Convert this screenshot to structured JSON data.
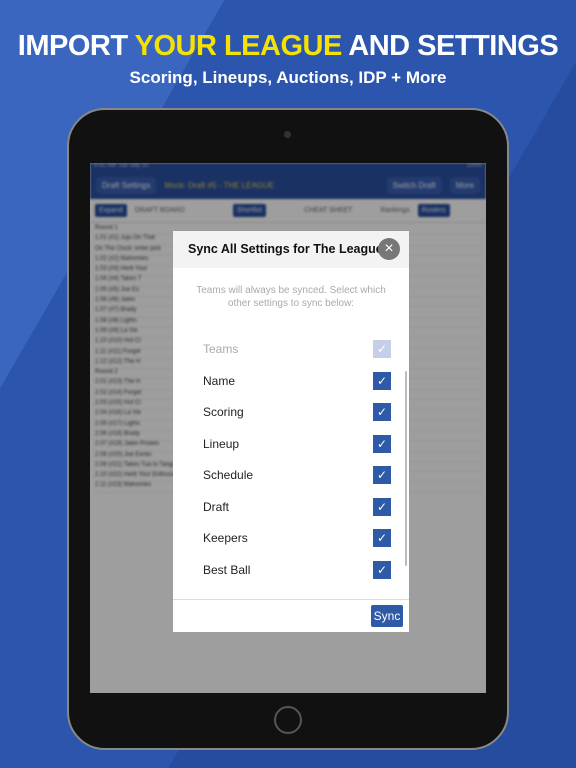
{
  "promo": {
    "headline_pre": "IMPORT ",
    "headline_highlight": "YOUR LEAGUE",
    "headline_post": " AND SETTINGS",
    "subtitle": "Scoring, Lineups, Auctions, IDP + More"
  },
  "app": {
    "status_time": "9:41 AM  Tue Sep 10",
    "status_battery": "100%",
    "draft_settings": "Draft Settings",
    "mock_title": "Mock: Draft #5 - THE LEAGUE",
    "switch_draft": "Switch Draft",
    "more": "More",
    "expand": "Expand",
    "draft_board": "DRAFT BOARD",
    "shortlist": "Shortlist",
    "cheat_sheet": "CHEAT SHEET",
    "rankings": "Rankings",
    "rosters": "Rosters",
    "rows": [
      "Round 1",
      "1.01 (#1) Juju On That",
      "On The Clock: enter pick",
      "1.02 (#2) Mahomies",
      "1.03 (#3) Herb Your",
      "1.04 (#4) Takes T",
      "1.05 (#5) Joe Ex",
      "1.06 (#6) Jalen",
      "1.07 (#7) Brady",
      "1.08 (#8) Lights",
      "1.09 (#9) La Vie",
      "1.10 (#10) Hot Cl",
      "1.11 (#11) Forget",
      "1.12 (#12) The H",
      "Round 2",
      "2.01 (#13) The H",
      "2.02 (#14) Forget",
      "2.03 (#15) Hot Cl",
      "2.04 (#16) La Vie",
      "2.05 (#17) Lights",
      "2.06 (#18) Brady",
      "2.07 (#19) Jalen Protein",
      "2.08 (#20) Joe Exotic",
      "2.09 (#21) Takes Tua to Tango",
      "2.10 (#22) Herb Your Enthusiasm",
      "2.11 (#23) Mahomies"
    ],
    "colors": {
      "header": "#2a4fa0",
      "accent": "#2f5aa8",
      "highlight": "#f6e200"
    }
  },
  "modal": {
    "title": "Sync All Settings for The League",
    "close_icon": "close-icon",
    "description": "Teams will always be synced. Select which other settings to sync below:",
    "options": [
      {
        "label": "Teams",
        "checked": true,
        "disabled": true
      },
      {
        "label": "Name",
        "checked": true
      },
      {
        "label": "Scoring",
        "checked": true
      },
      {
        "label": "Lineup",
        "checked": true
      },
      {
        "label": "Schedule",
        "checked": true
      },
      {
        "label": "Draft",
        "checked": true
      },
      {
        "label": "Keepers",
        "checked": true
      },
      {
        "label": "Best Ball",
        "checked": true
      }
    ],
    "sync_label": "Sync"
  }
}
